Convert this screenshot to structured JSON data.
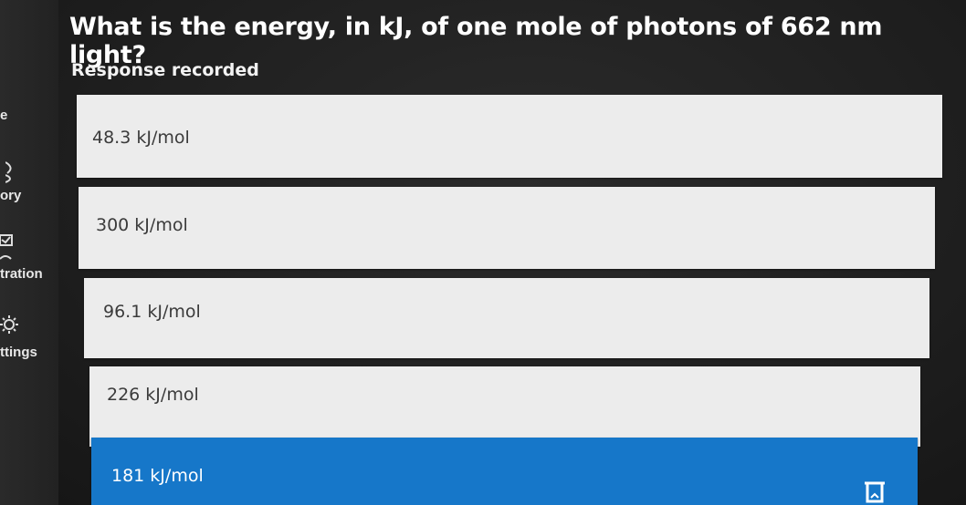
{
  "question": {
    "title": "What is the energy, in kJ, of one mole of photons of 662 nm light?",
    "status": "Response recorded"
  },
  "options": [
    {
      "label": "48.3 kJ/mol",
      "selected": false
    },
    {
      "label": "300 kJ/mol",
      "selected": false
    },
    {
      "label": "96.1 kJ/mol",
      "selected": false
    },
    {
      "label": "226 kJ/mol",
      "selected": false
    },
    {
      "label": "181 kJ/mol",
      "selected": true
    }
  ],
  "sidebar": {
    "items": [
      {
        "label": "e",
        "icon": "home-icon"
      },
      {
        "label": "ory",
        "icon": "history-icon"
      },
      {
        "label": "tration",
        "icon": "registration-icon"
      },
      {
        "label": "ttings",
        "icon": "gear-icon"
      }
    ]
  },
  "colors": {
    "selected": "#1677c9",
    "option_bg": "#ececec",
    "background": "#1e1e1e"
  },
  "footer": {
    "icon": "cup-icon"
  }
}
